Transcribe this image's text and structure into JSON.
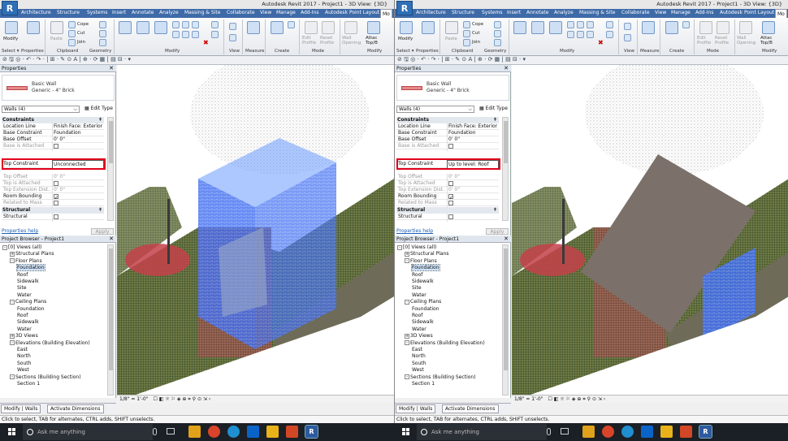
{
  "screens": [
    {
      "app_icon": "R",
      "title": "Autodesk Revit 2017 -    Project1 - 3D View: {3D}",
      "tabs": [
        "Architecture",
        "Structure",
        "Systems",
        "Insert",
        "Annotate",
        "Analyze",
        "Massing & Site",
        "Collaborate",
        "View",
        "Manage",
        "Add-Ins",
        "Autodesk Point Layout",
        "Mo"
      ],
      "ribbon": {
        "modify": "Modify",
        "paste": "Paste",
        "cope": "Cope",
        "cut": "Cut",
        "join": "Join",
        "groups": [
          "Select ▾",
          "Properties",
          "Clipboard",
          "Geometry",
          "Modify",
          "View",
          "Measure",
          "Create",
          "Mode",
          "Modify"
        ],
        "edit_profile": "Edit Profile",
        "reset_profile": "Reset Profile",
        "wall_opening": "Wall Opening",
        "attach": "Attac Top/B"
      },
      "qat": "⊘ 🖫 ◎ · ↶ · ↷ · | ⊞ · ✎ ⊙ A | ⊕ · ⟳ ▦ | ▤ ⊟ · ▾",
      "properties": {
        "header": "Properties",
        "type_family": "Basic Wall",
        "type_name": "Generic - 4\" Brick",
        "selector": "Walls (4)",
        "edit_type": "Edit Type",
        "constraints_label": "Constraints",
        "rows": [
          {
            "k": "Location Line",
            "v": "Finish Face: Exterior"
          },
          {
            "k": "Base Constraint",
            "v": "Foundation"
          },
          {
            "k": "Base Offset",
            "v": "0'  0\""
          },
          {
            "k": "Base is Attached",
            "v": ""
          }
        ],
        "top_constraint_label": "Top Constraint",
        "top_constraint_value": "Unconnected",
        "rows2": [
          {
            "k": "Top Offset",
            "v": "0'  0\""
          },
          {
            "k": "Top is Attached",
            "v": ""
          },
          {
            "k": "Top Extension Dist...",
            "v": "0'  0\""
          },
          {
            "k": "Room Bounding",
            "v": ""
          },
          {
            "k": "Related to Mass",
            "v": ""
          }
        ],
        "structural_label": "Structural",
        "structural_row": "Structural",
        "help": "Properties help",
        "apply": "Apply"
      },
      "browser": {
        "header": "Project Browser - Project1",
        "items": [
          {
            "t": "[0] Views (all)",
            "lvl": 0,
            "box": "-"
          },
          {
            "t": "Structural Plans",
            "lvl": 1,
            "box": "+"
          },
          {
            "t": "Floor Plans",
            "lvl": 1,
            "box": "-"
          },
          {
            "t": "Foundation",
            "lvl": 2,
            "sel": true
          },
          {
            "t": "Roof",
            "lvl": 2
          },
          {
            "t": "Sidewalk",
            "lvl": 2
          },
          {
            "t": "Site",
            "lvl": 2
          },
          {
            "t": "Water",
            "lvl": 2
          },
          {
            "t": "Ceiling Plans",
            "lvl": 1,
            "box": "-"
          },
          {
            "t": "Foundation",
            "lvl": 2
          },
          {
            "t": "Roof",
            "lvl": 2
          },
          {
            "t": "Sidewalk",
            "lvl": 2
          },
          {
            "t": "Water",
            "lvl": 2
          },
          {
            "t": "3D Views",
            "lvl": 1,
            "box": "+"
          },
          {
            "t": "Elevations (Building Elevation)",
            "lvl": 1,
            "box": "-"
          },
          {
            "t": "East",
            "lvl": 2
          },
          {
            "t": "North",
            "lvl": 2
          },
          {
            "t": "South",
            "lvl": 2
          },
          {
            "t": "West",
            "lvl": 2
          },
          {
            "t": "Sections (Building Section)",
            "lvl": 1,
            "box": "-"
          },
          {
            "t": "Section 1",
            "lvl": 2
          }
        ]
      },
      "bottom_tabs": [
        "Modify | Walls",
        "Activate Dimensions"
      ],
      "view_scale": "1/8\" = 1'-0\"",
      "status": "Click to select, TAB for alternates, CTRL adds, SHIFT unselects."
    },
    {
      "app_icon": "R",
      "title": "Autodesk Revit 2017 -    Project1 - 3D View: {3D}",
      "tabs": [
        "Architecture",
        "Structure",
        "Systems",
        "Insert",
        "Annotate",
        "Analyze",
        "Massing & Site",
        "Collaborate",
        "View",
        "Manage",
        "Add-Ins",
        "Autodesk Point Layout",
        "Mo"
      ],
      "ribbon": {
        "modify": "Modify",
        "paste": "Paste",
        "cope": "Cope",
        "cut": "Cut",
        "join": "Join",
        "groups": [
          "Select ▾",
          "Properties",
          "Clipboard",
          "Geometry",
          "Modify",
          "View",
          "Measure",
          "Create",
          "Mode",
          "Modify"
        ],
        "edit_profile": "Edit Profile",
        "reset_profile": "Reset Profile",
        "wall_opening": "Wall Opening",
        "attach": "Attac Top/B"
      },
      "qat": "⊘ 🖫 ◎ · ↶ · ↷ · | ⊞ · ✎ ⊙ A | ⊕ · ⟳ ▦ | ▤ ⊟ · ▾",
      "properties": {
        "header": "Properties",
        "type_family": "Basic Wall",
        "type_name": "Generic - 4\" Brick",
        "selector": "Walls (4)",
        "edit_type": "Edit Type",
        "constraints_label": "Constraints",
        "rows": [
          {
            "k": "Location Line",
            "v": "Finish Face: Exterior"
          },
          {
            "k": "Base Constraint",
            "v": "Foundation"
          },
          {
            "k": "Base Offset",
            "v": "0'  0\""
          },
          {
            "k": "Base is Attached",
            "v": ""
          }
        ],
        "top_constraint_label": "Top Constraint",
        "top_constraint_value": "Up to level: Roof",
        "rows2": [
          {
            "k": "Top Offset",
            "v": "0'  0\""
          },
          {
            "k": "Top is Attached",
            "v": ""
          },
          {
            "k": "Top Extension Dist...",
            "v": "0'  0\""
          },
          {
            "k": "Room Bounding",
            "v": ""
          },
          {
            "k": "Related to Mass",
            "v": ""
          }
        ],
        "structural_label": "Structural",
        "structural_row": "Structural",
        "help": "Properties help",
        "apply": "Apply"
      },
      "browser": {
        "header": "Project Browser - Project1",
        "items": [
          {
            "t": "[0] Views (all)",
            "lvl": 0,
            "box": "-"
          },
          {
            "t": "Structural Plans",
            "lvl": 1,
            "box": "+"
          },
          {
            "t": "Floor Plans",
            "lvl": 1,
            "box": "-"
          },
          {
            "t": "Foundation",
            "lvl": 2,
            "sel": true
          },
          {
            "t": "Roof",
            "lvl": 2
          },
          {
            "t": "Sidewalk",
            "lvl": 2
          },
          {
            "t": "Site",
            "lvl": 2
          },
          {
            "t": "Water",
            "lvl": 2
          },
          {
            "t": "Ceiling Plans",
            "lvl": 1,
            "box": "-"
          },
          {
            "t": "Foundation",
            "lvl": 2
          },
          {
            "t": "Roof",
            "lvl": 2
          },
          {
            "t": "Sidewalk",
            "lvl": 2
          },
          {
            "t": "Water",
            "lvl": 2
          },
          {
            "t": "3D Views",
            "lvl": 1,
            "box": "+"
          },
          {
            "t": "Elevations (Building Elevation)",
            "lvl": 1,
            "box": "-"
          },
          {
            "t": "East",
            "lvl": 2
          },
          {
            "t": "North",
            "lvl": 2
          },
          {
            "t": "South",
            "lvl": 2
          },
          {
            "t": "West",
            "lvl": 2
          },
          {
            "t": "Sections (Building Section)",
            "lvl": 1,
            "box": "-"
          },
          {
            "t": "Section 1",
            "lvl": 2
          }
        ]
      },
      "bottom_tabs": [
        "Modify | Walls",
        "Activate Dimensions"
      ],
      "view_scale": "1/8\" = 1'-0\"",
      "status": "Click to select, TAB for alternates, CTRL adds, SHIFT unselects."
    }
  ],
  "taskbar": [
    {
      "search_placeholder": "Ask me anything"
    },
    {
      "search_placeholder": "Ask me anything"
    }
  ],
  "colors": {
    "ribbon_tab_bar": "#3e6aa8",
    "selection_highlight": "#e0001b",
    "wall_selection": "#2f64e0",
    "taskbar": "#1b1f26"
  }
}
